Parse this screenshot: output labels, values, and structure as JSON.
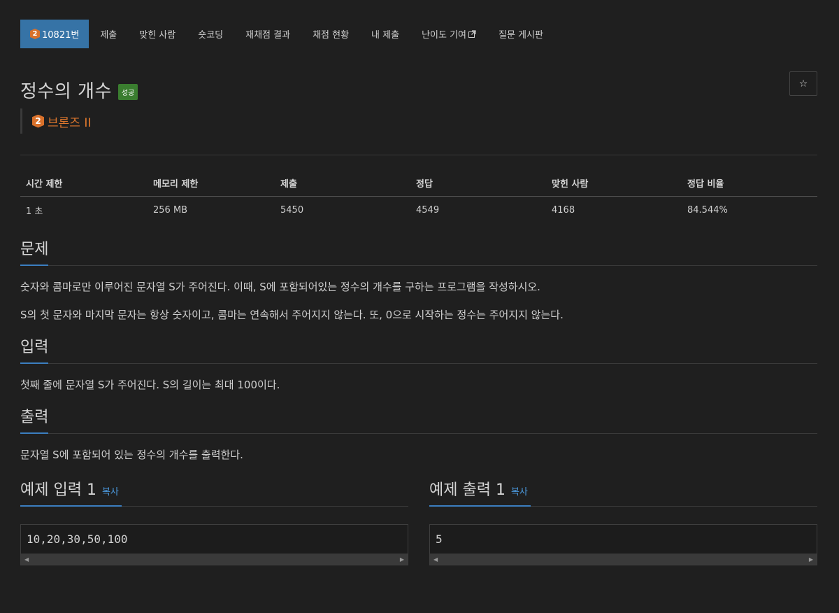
{
  "tabs": [
    {
      "label": "10821번",
      "tier": "2"
    },
    {
      "label": "제출"
    },
    {
      "label": "맞힌 사람"
    },
    {
      "label": "숏코딩"
    },
    {
      "label": "재채점 결과"
    },
    {
      "label": "채점 현황"
    },
    {
      "label": "내 제출"
    },
    {
      "label": "난이도 기여"
    },
    {
      "label": "질문 게시판"
    }
  ],
  "problem": {
    "title": "정수의 개수",
    "status_badge": "성공",
    "tier_number": "2",
    "tier_name": "브론즈 II",
    "star_icon": "☆"
  },
  "stats": {
    "headers": [
      "시간 제한",
      "메모리 제한",
      "제출",
      "정답",
      "맞힌 사람",
      "정답 비율"
    ],
    "values": [
      "1 초",
      "256 MB",
      "5450",
      "4549",
      "4168",
      "84.544%"
    ]
  },
  "sections": {
    "problem": {
      "title": "문제",
      "paragraphs": [
        "숫자와 콤마로만 이루어진 문자열 S가 주어진다. 이때, S에 포함되어있는 정수의 개수를 구하는 프로그램을 작성하시오.",
        "S의 첫 문자와 마지막 문자는 항상 숫자이고, 콤마는 연속해서 주어지지 않는다. 또, 0으로 시작하는 정수는 주어지지 않는다."
      ]
    },
    "input": {
      "title": "입력",
      "paragraphs": [
        "첫째 줄에 문자열 S가 주어진다. S의 길이는 최대 100이다."
      ]
    },
    "output": {
      "title": "출력",
      "paragraphs": [
        "문자열 S에 포함되어 있는 정수의 개수를 출력한다."
      ]
    }
  },
  "samples": [
    {
      "title": "예제 입력 1",
      "copy_label": "복사",
      "content": "10,20,30,50,100"
    },
    {
      "title": "예제 출력 1",
      "copy_label": "복사",
      "content": "5"
    }
  ],
  "colors": {
    "accent": "#3673a6",
    "tier_bronze": "#e0782d",
    "success": "#3a7d2f",
    "link": "#4c9be0"
  }
}
